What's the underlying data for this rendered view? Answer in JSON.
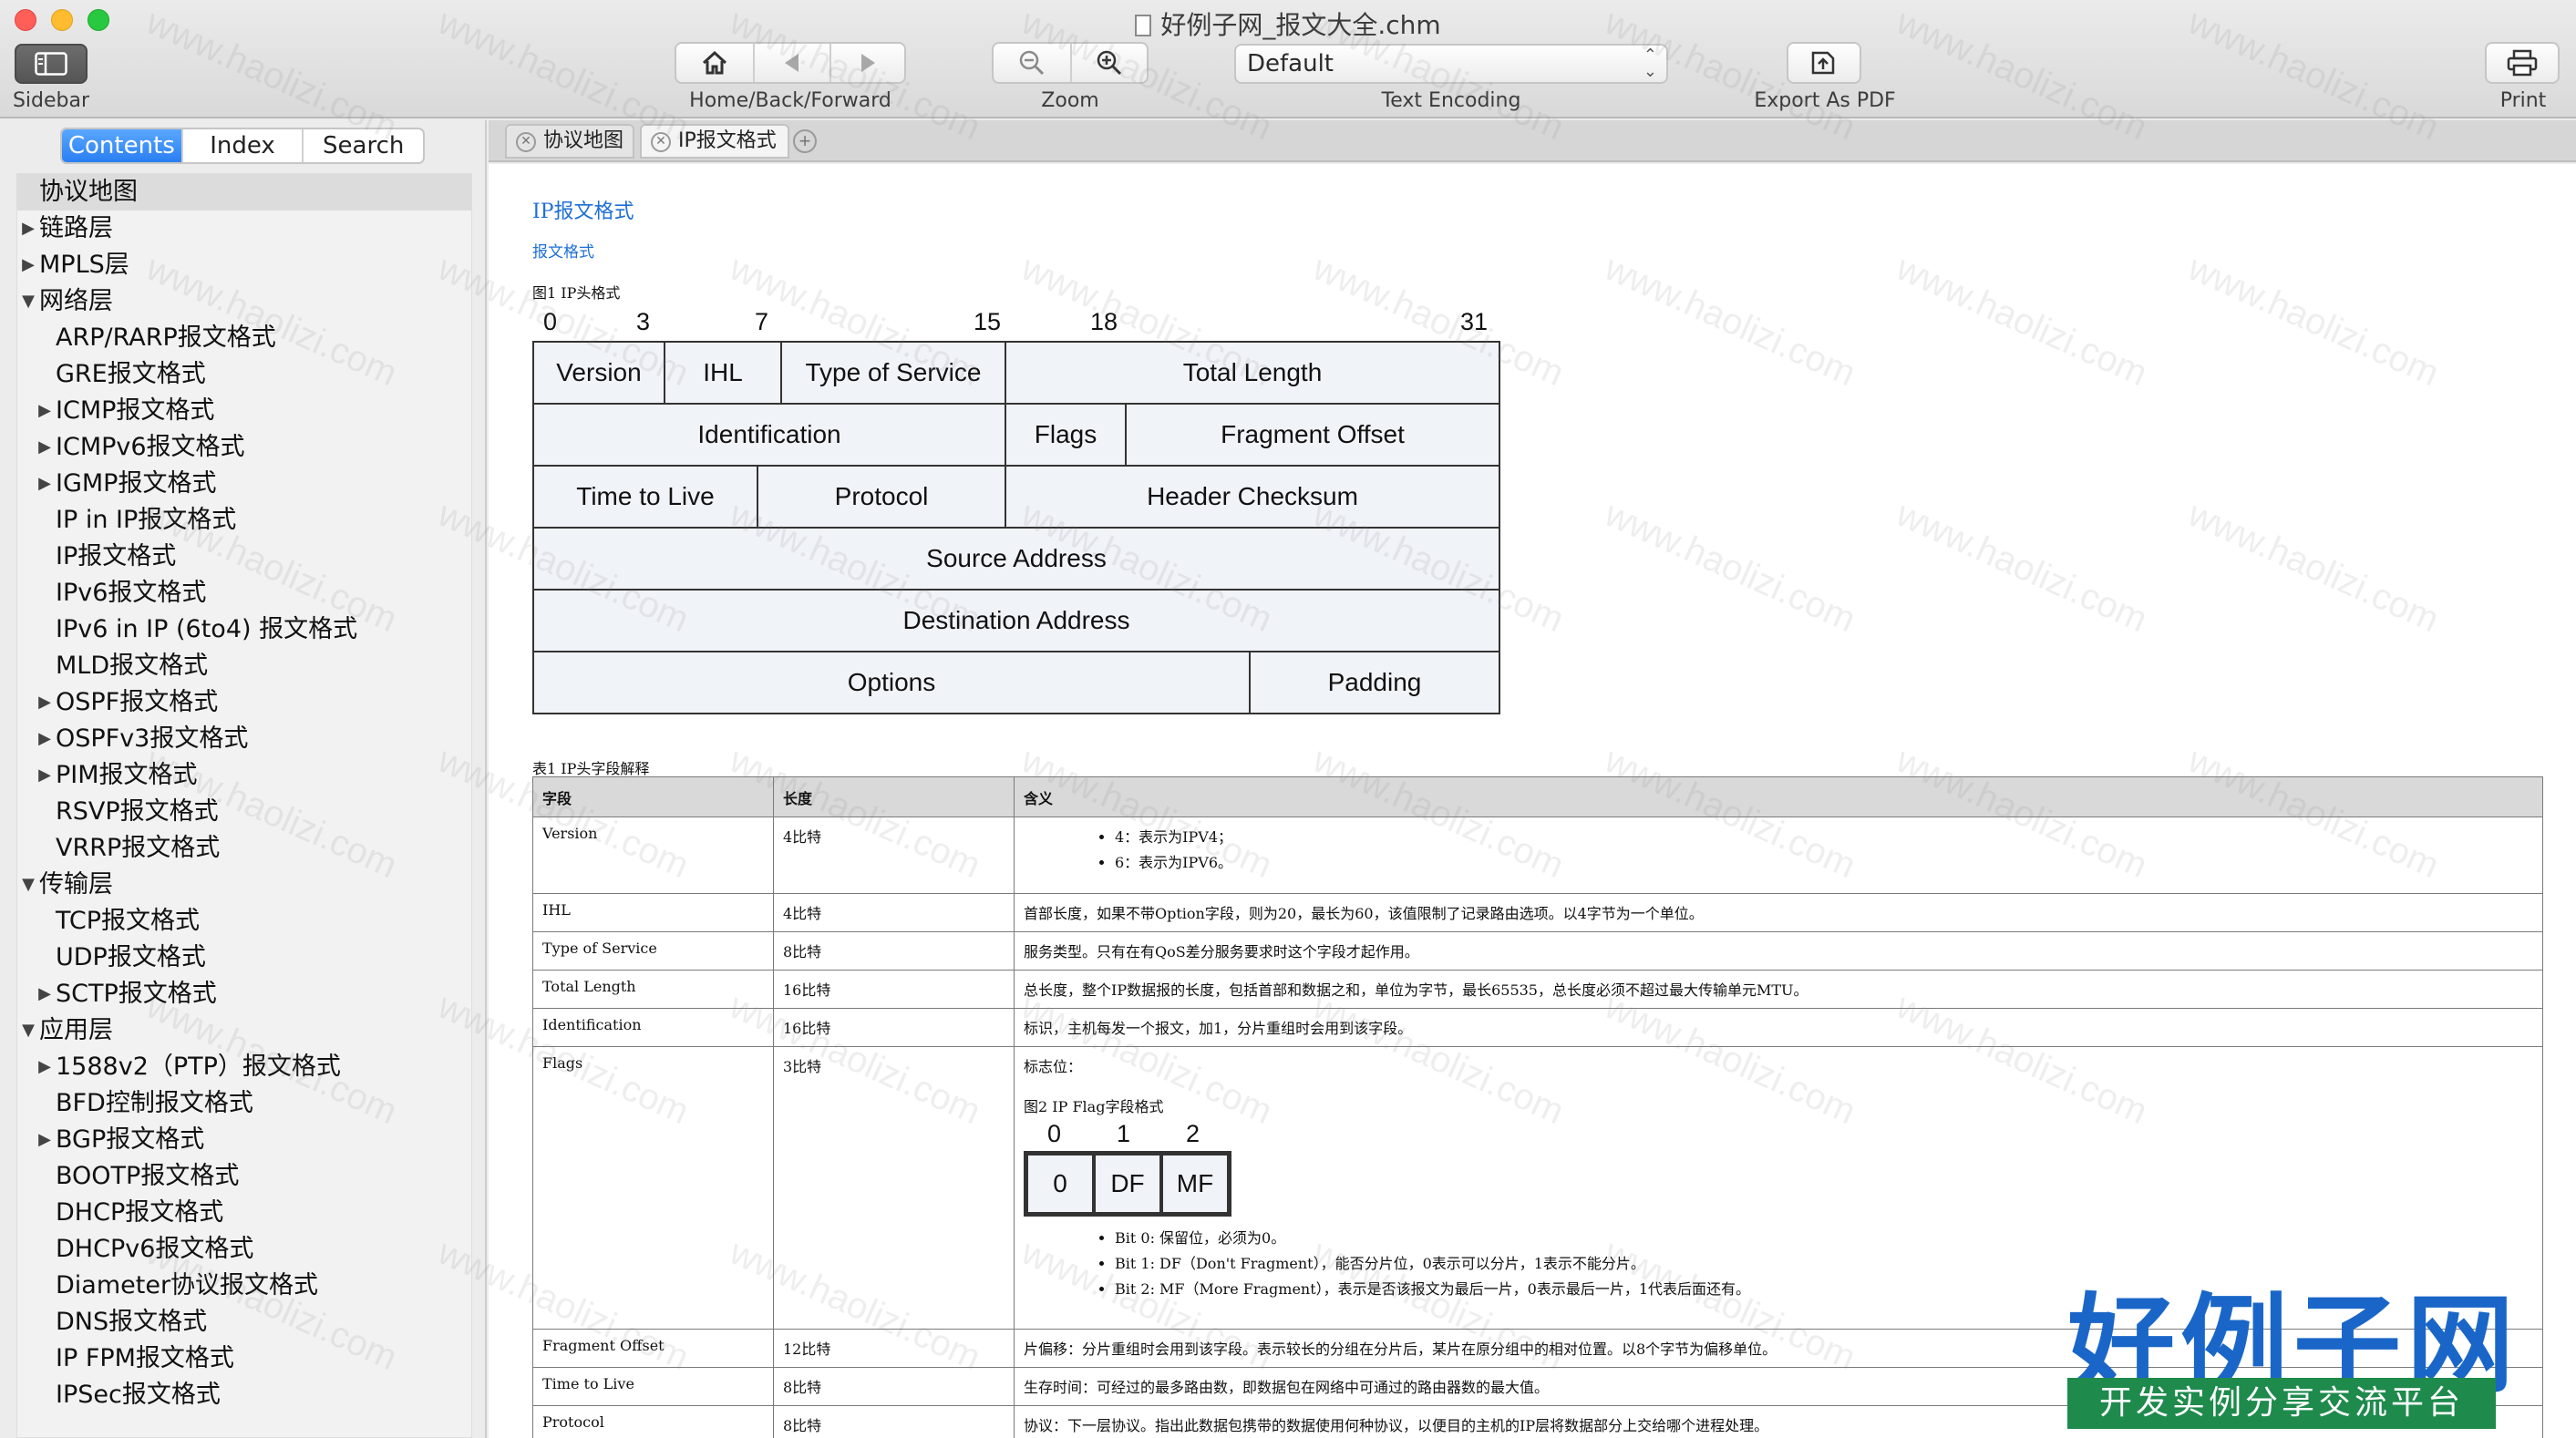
{
  "window": {
    "title": "好例子网_报文大全.chm"
  },
  "toolbar": {
    "sidebar_label": "Sidebar",
    "nav_label": "Home/Back/Forward",
    "zoom_label": "Zoom",
    "encoding_value": "Default",
    "encoding_label": "Text Encoding",
    "export_label": "Export As PDF",
    "print_label": "Print"
  },
  "sidebar": {
    "tabs": [
      "Contents",
      "Index",
      "Search"
    ],
    "active_tab": "Contents",
    "tree": [
      {
        "label": "协议地图",
        "level": 0,
        "arrow": "",
        "selected": true
      },
      {
        "label": "链路层",
        "level": 0,
        "arrow": "▶"
      },
      {
        "label": "MPLS层",
        "level": 0,
        "arrow": "▶"
      },
      {
        "label": "网络层",
        "level": 0,
        "arrow": "▼"
      },
      {
        "label": "ARP/RARP报文格式",
        "level": 1,
        "arrow": ""
      },
      {
        "label": "GRE报文格式",
        "level": 1,
        "arrow": ""
      },
      {
        "label": "ICMP报文格式",
        "level": 1,
        "arrow": "▶"
      },
      {
        "label": "ICMPv6报文格式",
        "level": 1,
        "arrow": "▶"
      },
      {
        "label": "IGMP报文格式",
        "level": 1,
        "arrow": "▶"
      },
      {
        "label": "IP in IP报文格式",
        "level": 1,
        "arrow": ""
      },
      {
        "label": "IP报文格式",
        "level": 1,
        "arrow": ""
      },
      {
        "label": "IPv6报文格式",
        "level": 1,
        "arrow": ""
      },
      {
        "label": "IPv6 in IP (6to4) 报文格式",
        "level": 1,
        "arrow": ""
      },
      {
        "label": "MLD报文格式",
        "level": 1,
        "arrow": ""
      },
      {
        "label": "OSPF报文格式",
        "level": 1,
        "arrow": "▶"
      },
      {
        "label": "OSPFv3报文格式",
        "level": 1,
        "arrow": "▶"
      },
      {
        "label": "PIM报文格式",
        "level": 1,
        "arrow": "▶"
      },
      {
        "label": "RSVP报文格式",
        "level": 1,
        "arrow": ""
      },
      {
        "label": "VRRP报文格式",
        "level": 1,
        "arrow": ""
      },
      {
        "label": "传输层",
        "level": 0,
        "arrow": "▼"
      },
      {
        "label": "TCP报文格式",
        "level": 1,
        "arrow": ""
      },
      {
        "label": "UDP报文格式",
        "level": 1,
        "arrow": ""
      },
      {
        "label": "SCTP报文格式",
        "level": 1,
        "arrow": "▶"
      },
      {
        "label": "应用层",
        "level": 0,
        "arrow": "▼"
      },
      {
        "label": "1588v2（PTP）报文格式",
        "level": 1,
        "arrow": "▶"
      },
      {
        "label": "BFD控制报文格式",
        "level": 1,
        "arrow": ""
      },
      {
        "label": "BGP报文格式",
        "level": 1,
        "arrow": "▶"
      },
      {
        "label": "BOOTP报文格式",
        "level": 1,
        "arrow": ""
      },
      {
        "label": "DHCP报文格式",
        "level": 1,
        "arrow": ""
      },
      {
        "label": "DHCPv6报文格式",
        "level": 1,
        "arrow": ""
      },
      {
        "label": "Diameter协议报文格式",
        "level": 1,
        "arrow": ""
      },
      {
        "label": "DNS报文格式",
        "level": 1,
        "arrow": ""
      },
      {
        "label": "IP FPM报文格式",
        "level": 1,
        "arrow": ""
      },
      {
        "label": "IPSec报文格式",
        "level": 1,
        "arrow": ""
      }
    ]
  },
  "tabs": [
    {
      "label": "协议地图",
      "active": false
    },
    {
      "label": "IP报文格式",
      "active": true
    }
  ],
  "doc": {
    "title": "IP报文格式",
    "subtitle": "报文格式",
    "figure1_caption": "图1 IP头格式",
    "bit_numbers": [
      "0",
      "3",
      "7",
      "15",
      "18",
      "31"
    ],
    "header_fields": {
      "version": "Version",
      "ihl": "IHL",
      "tos": "Type of Service",
      "total_length": "Total Length",
      "identification": "Identification",
      "flags": "Flags",
      "fragment_offset": "Fragment Offset",
      "ttl": "Time to Live",
      "protocol": "Protocol",
      "checksum": "Header Checksum",
      "source": "Source Address",
      "destination": "Destination Address",
      "options": "Options",
      "padding": "Padding"
    },
    "table_caption": "表1 IP头字段解释",
    "table_headers": [
      "字段",
      "长度",
      "含义"
    ],
    "rows": {
      "version": {
        "field": "Version",
        "length": "4比特",
        "bullets": [
          "4：表示为IPV4；",
          "6：表示为IPV6。"
        ]
      },
      "ihl": {
        "field": "IHL",
        "length": "4比特",
        "meaning": "首部长度，如果不带Option字段，则为20，最长为60，该值限制了记录路由选项。以4字节为一个单位。"
      },
      "tos": {
        "field": "Type of Service",
        "length": "8比特",
        "meaning": "服务类型。只有在有QoS差分服务要求时这个字段才起作用。"
      },
      "total_length": {
        "field": "Total Length",
        "length": "16比特",
        "meaning": "总长度，整个IP数据报的长度，包括首部和数据之和，单位为字节，最长65535，总长度必须不超过最大传输单元MTU。"
      },
      "identification": {
        "field": "Identification",
        "length": "16比特",
        "meaning": "标识，主机每发一个报文，加1，分片重组时会用到该字段。"
      },
      "flags": {
        "field": "Flags",
        "length": "3比特",
        "meaning": "标志位：",
        "figure_caption": "图2 IP Flag字段格式",
        "bit_numbers": [
          "0",
          "1",
          "2"
        ],
        "cells": [
          "0",
          "DF",
          "MF"
        ],
        "bullets": [
          "Bit 0: 保留位，必须为0。",
          "Bit 1: DF（Don't Fragment），能否分片位，0表示可以分片，1表示不能分片。",
          "Bit 2: MF（More Fragment），表示是否该报文为最后一片，0表示最后一片，1代表后面还有。"
        ]
      },
      "fragment_offset": {
        "field": "Fragment Offset",
        "length": "12比特",
        "meaning": "片偏移：分片重组时会用到该字段。表示较长的分组在分片后，某片在原分组中的相对位置。以8个字节为偏移单位。"
      },
      "ttl": {
        "field": "Time to Live",
        "length": "8比特",
        "meaning": "生存时间：可经过的最多路由数，即数据包在网络中可通过的路由器数的最大值。"
      },
      "protocol": {
        "field": "Protocol",
        "length": "8比特",
        "meaning": "协议：下一层协议。指出此数据包携带的数据使用何种协议，以便目的主机的IP层将数据部分上交给哪个进程处理。"
      }
    }
  },
  "watermark": "www.haolizi.com",
  "logo": {
    "main": "好例子网",
    "sub": "开发实例分享交流平台",
    "main_color": "#1a66c8",
    "sub_color": "#1e8a4c"
  }
}
